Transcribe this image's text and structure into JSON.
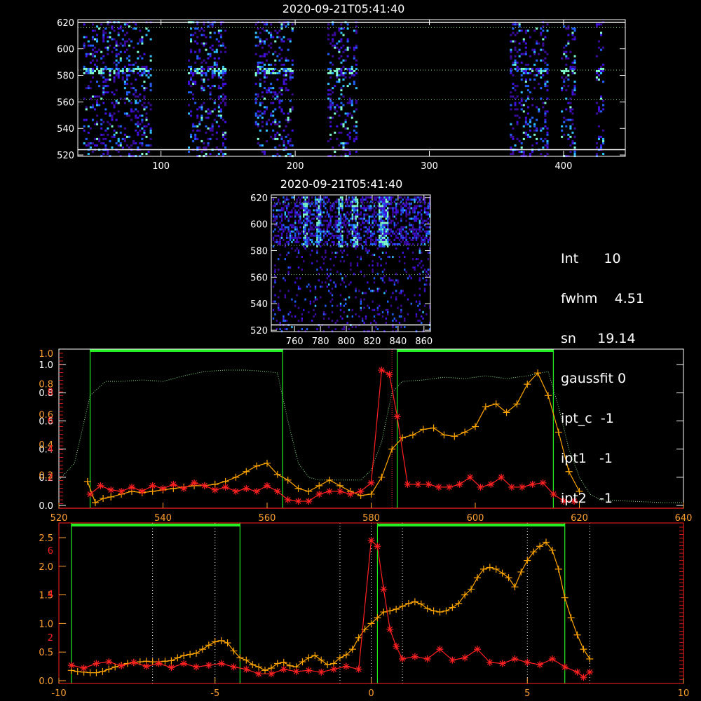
{
  "panel_titles": {
    "top": "2020-09-21T05:41:40",
    "middle": "2020-09-21T05:41:40"
  },
  "info": {
    "lines": [
      {
        "label": "Int",
        "value": "10"
      },
      {
        "label": "fwhm",
        "value": "4.51"
      },
      {
        "label": "sn",
        "value": "19.14"
      },
      {
        "label": "gaussfit",
        "value": "0"
      },
      {
        "label": "ipt_c",
        "value": "-1"
      },
      {
        "label": "ipt1",
        "value": "-1"
      },
      {
        "label": "ipt2",
        "value": "-1"
      }
    ]
  },
  "colors": {
    "axis": "#ffffff",
    "axis_red": "#ff2020",
    "axis_orange": "#ffa030",
    "green": "#22ee22",
    "dotted_green": "#88dd88",
    "orange_line": "#ffa500",
    "red_line": "#ff2020"
  },
  "chart_data": [
    {
      "type": "heatmap",
      "title": "2020-09-21T05:41:40",
      "xlim": [
        38,
        446
      ],
      "ylim": [
        519,
        622
      ],
      "xticks": [
        "100",
        "200",
        "300",
        "400"
      ],
      "xtick_values": [
        100,
        200,
        300,
        400
      ],
      "yticks": [
        "520",
        "540",
        "560",
        "580",
        "600",
        "620"
      ],
      "ytick_values": [
        520,
        540,
        560,
        580,
        600,
        620
      ],
      "hlines_dotted": [
        616,
        584,
        562
      ],
      "hlines_solid": [
        524,
        620
      ],
      "bands": [
        [
          42,
          92
        ],
        [
          120,
          148
        ],
        [
          170,
          198
        ],
        [
          224,
          246
        ],
        [
          360,
          388
        ],
        [
          398,
          408
        ],
        [
          424,
          430
        ]
      ],
      "strong_row": 584
    },
    {
      "type": "heatmap",
      "title": "2020-09-21T05:41:40",
      "xlim": [
        742,
        865
      ],
      "ylim": [
        519,
        622
      ],
      "xticks": [
        "760",
        "780",
        "800",
        "820",
        "840",
        "860"
      ],
      "xtick_values": [
        760,
        780,
        800,
        820,
        840,
        860
      ],
      "yticks": [
        "520",
        "540",
        "560",
        "580",
        "600",
        "620"
      ],
      "ytick_values": [
        520,
        540,
        560,
        580,
        600,
        620
      ],
      "hlines_dotted": [
        616,
        584,
        562
      ],
      "hlines_solid": [
        524
      ],
      "hot_columns": [
        768,
        778,
        795,
        806,
        826,
        830
      ]
    },
    {
      "type": "line",
      "xlim": [
        520,
        640
      ],
      "xticks": [
        "520",
        "540",
        "560",
        "580",
        "600",
        "620",
        "640"
      ],
      "xtick_values": [
        520,
        540,
        560,
        580,
        600,
        620,
        640
      ],
      "left_axis_white": {
        "ticks": [
          "0.0",
          "0.2",
          "0.4",
          "0.6",
          "0.8",
          "1.0"
        ],
        "values": [
          0,
          0.2,
          0.4,
          0.6,
          0.8,
          1.0
        ]
      },
      "left_axis_orange": {
        "ticks": [
          "0.2",
          "0.4",
          "0.6",
          "0.8",
          "1.0"
        ],
        "values": [
          0.2,
          0.4,
          0.6,
          0.8,
          1.0
        ]
      },
      "left_axis_red": {
        "ticks": [
          "2",
          "4",
          "6",
          "8"
        ],
        "values": [
          2,
          4,
          6,
          8
        ]
      },
      "green_windows": [
        [
          526,
          563
        ],
        [
          585,
          615
        ]
      ],
      "red_dotted_vline": 584,
      "series": [
        {
          "style": "dotted-green",
          "x": [
            520,
            523,
            526,
            529,
            532,
            536,
            540,
            544,
            548,
            552,
            556,
            560,
            562,
            564,
            566,
            568,
            570,
            574,
            578,
            580,
            582,
            584,
            586,
            590,
            594,
            598,
            602,
            606,
            610,
            614,
            616,
            618,
            620,
            622,
            624,
            630,
            636,
            640
          ],
          "y": [
            0.18,
            0.3,
            0.78,
            0.88,
            0.88,
            0.89,
            0.88,
            0.92,
            0.95,
            0.96,
            0.96,
            0.95,
            0.94,
            0.6,
            0.3,
            0.2,
            0.18,
            0.18,
            0.18,
            0.25,
            0.45,
            0.8,
            0.88,
            0.89,
            0.91,
            0.9,
            0.92,
            0.9,
            0.92,
            0.95,
            0.7,
            0.4,
            0.2,
            0.08,
            0.04,
            0.03,
            0.02,
            0.02
          ]
        },
        {
          "style": "orange-plus",
          "x": [
            525.5,
            527,
            528.5,
            530,
            532,
            534,
            536,
            538,
            540,
            542,
            544,
            546,
            548,
            550,
            552,
            554,
            556,
            558,
            560,
            562,
            564,
            566,
            568,
            570,
            572,
            574,
            576,
            578,
            580,
            582,
            584,
            586,
            588,
            590,
            592,
            594,
            596,
            598,
            600,
            602,
            604,
            606,
            608,
            610,
            612,
            614,
            616,
            618,
            620
          ],
          "y": [
            0.17,
            0.02,
            0.05,
            0.06,
            0.08,
            0.1,
            0.09,
            0.1,
            0.11,
            0.12,
            0.13,
            0.14,
            0.14,
            0.15,
            0.17,
            0.2,
            0.24,
            0.28,
            0.3,
            0.22,
            0.18,
            0.12,
            0.1,
            0.14,
            0.18,
            0.14,
            0.1,
            0.07,
            0.08,
            0.2,
            0.4,
            0.48,
            0.5,
            0.54,
            0.55,
            0.5,
            0.49,
            0.52,
            0.56,
            0.7,
            0.72,
            0.66,
            0.72,
            0.86,
            0.94,
            0.78,
            0.52,
            0.24,
            0.1
          ]
        },
        {
          "style": "red-star",
          "x": [
            526,
            528,
            530,
            532,
            534,
            536,
            538,
            540,
            542,
            544,
            546,
            548,
            550,
            552,
            554,
            556,
            558,
            560,
            562,
            564,
            566,
            568,
            570,
            572,
            574,
            576,
            578,
            580,
            582,
            583.5,
            585,
            587,
            589,
            591,
            593,
            595,
            597,
            599,
            601,
            603,
            605,
            607,
            609,
            611,
            613,
            615,
            617,
            619
          ],
          "y": [
            0.08,
            0.14,
            0.11,
            0.1,
            0.13,
            0.1,
            0.14,
            0.12,
            0.15,
            0.12,
            0.16,
            0.14,
            0.11,
            0.13,
            0.1,
            0.12,
            0.1,
            0.14,
            0.1,
            0.04,
            0.03,
            0.03,
            0.08,
            0.1,
            0.1,
            0.08,
            0.1,
            0.16,
            0.96,
            0.93,
            0.63,
            0.15,
            0.15,
            0.15,
            0.13,
            0.13,
            0.15,
            0.2,
            0.13,
            0.15,
            0.2,
            0.13,
            0.13,
            0.15,
            0.16,
            0.08,
            0.03,
            0.03
          ]
        }
      ]
    },
    {
      "type": "line",
      "xlim": [
        -10,
        10
      ],
      "xticks": [
        "-10",
        "-5",
        "0",
        "5",
        "10"
      ],
      "xtick_values": [
        -10,
        -5,
        0,
        5,
        10
      ],
      "left_axis_orange": {
        "ticks": [
          "0.0",
          "0.5",
          "1.0",
          "1.5",
          "2.0",
          "2.5"
        ],
        "values": [
          0,
          0.5,
          1.0,
          1.5,
          2.0,
          2.5
        ]
      },
      "left_axis_red": {
        "ticks": [
          "2",
          "4",
          "6"
        ],
        "values": [
          2,
          4,
          6
        ]
      },
      "ylim": [
        0,
        2.6
      ],
      "green_windows": [
        [
          -9.6,
          -4.2
        ],
        [
          0.2,
          6.2
        ]
      ],
      "white_dotted_vlines": [
        -7,
        -5,
        -1,
        0,
        1,
        5,
        7
      ],
      "series": [
        {
          "style": "orange-plus",
          "x": [
            -9.6,
            -9.4,
            -9.2,
            -9.0,
            -8.8,
            -8.6,
            -8.4,
            -8.2,
            -8.0,
            -7.8,
            -7.6,
            -7.4,
            -7.2,
            -7.0,
            -6.8,
            -6.6,
            -6.4,
            -6.2,
            -6.0,
            -5.8,
            -5.6,
            -5.4,
            -5.2,
            -5.0,
            -4.8,
            -4.6,
            -4.4,
            -4.2,
            -4.0,
            -3.8,
            -3.6,
            -3.4,
            -3.2,
            -3.0,
            -2.8,
            -2.6,
            -2.4,
            -2.2,
            -2.0,
            -1.8,
            -1.6,
            -1.4,
            -1.2,
            -1.0,
            -0.8,
            -0.6,
            -0.4,
            -0.2,
            0.0,
            0.2,
            0.4,
            0.6,
            0.8,
            1.0,
            1.2,
            1.4,
            1.6,
            1.8,
            2.0,
            2.2,
            2.4,
            2.6,
            2.8,
            3.0,
            3.2,
            3.4,
            3.6,
            3.8,
            4.0,
            4.2,
            4.4,
            4.6,
            4.8,
            5.0,
            5.2,
            5.4,
            5.6,
            5.8,
            6.0,
            6.2,
            6.4,
            6.6,
            6.8,
            7.0
          ],
          "y": [
            0.18,
            0.16,
            0.15,
            0.14,
            0.14,
            0.16,
            0.2,
            0.24,
            0.27,
            0.3,
            0.32,
            0.33,
            0.34,
            0.33,
            0.33,
            0.34,
            0.35,
            0.4,
            0.44,
            0.46,
            0.48,
            0.55,
            0.62,
            0.68,
            0.7,
            0.66,
            0.52,
            0.4,
            0.36,
            0.28,
            0.24,
            0.18,
            0.22,
            0.3,
            0.32,
            0.26,
            0.24,
            0.33,
            0.4,
            0.44,
            0.36,
            0.28,
            0.3,
            0.4,
            0.45,
            0.55,
            0.75,
            0.9,
            1.0,
            1.1,
            1.2,
            1.22,
            1.25,
            1.3,
            1.35,
            1.38,
            1.34,
            1.26,
            1.22,
            1.2,
            1.22,
            1.28,
            1.35,
            1.5,
            1.6,
            1.8,
            1.95,
            1.98,
            1.95,
            1.88,
            1.8,
            1.64,
            1.9,
            2.1,
            2.25,
            2.35,
            2.42,
            2.28,
            1.95,
            1.45,
            1.1,
            0.8,
            0.55,
            0.38
          ]
        },
        {
          "style": "red-star",
          "x": [
            -9.6,
            -9.2,
            -8.8,
            -8.4,
            -8.0,
            -7.6,
            -7.2,
            -6.8,
            -6.4,
            -6.0,
            -5.6,
            -5.2,
            -4.8,
            -4.4,
            -4.0,
            -3.6,
            -3.2,
            -2.8,
            -2.4,
            -2.0,
            -1.6,
            -1.2,
            -0.8,
            -0.4,
            0.0,
            0.2,
            0.4,
            0.6,
            0.8,
            1.0,
            1.4,
            1.8,
            2.2,
            2.6,
            3.0,
            3.4,
            3.8,
            4.2,
            4.6,
            5.0,
            5.4,
            5.8,
            6.2,
            6.6,
            6.8,
            7.0
          ],
          "y": [
            0.27,
            0.22,
            0.3,
            0.33,
            0.26,
            0.32,
            0.25,
            0.3,
            0.23,
            0.3,
            0.24,
            0.27,
            0.3,
            0.24,
            0.2,
            0.12,
            0.12,
            0.2,
            0.16,
            0.18,
            0.15,
            0.2,
            0.25,
            0.2,
            2.45,
            2.35,
            1.6,
            0.9,
            0.6,
            0.38,
            0.42,
            0.38,
            0.55,
            0.36,
            0.4,
            0.55,
            0.32,
            0.3,
            0.38,
            0.32,
            0.28,
            0.38,
            0.24,
            0.15,
            0.06,
            0.15
          ]
        }
      ]
    }
  ]
}
